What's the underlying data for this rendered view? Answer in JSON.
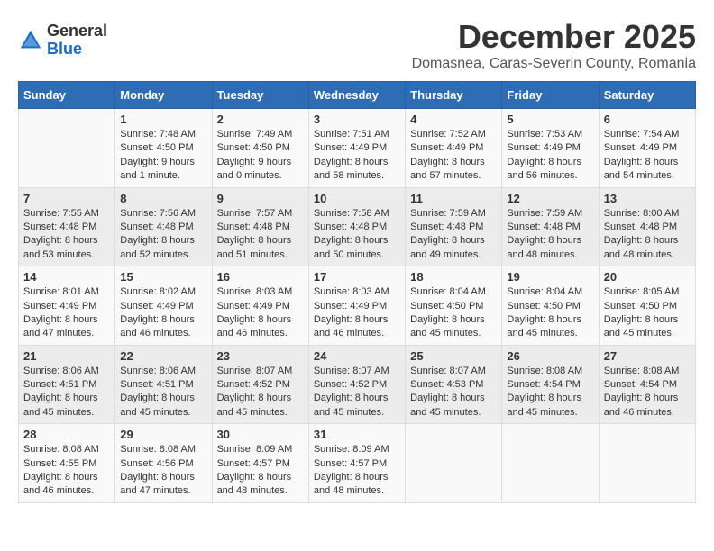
{
  "header": {
    "logo_general": "General",
    "logo_blue": "Blue",
    "title": "December 2025",
    "subtitle": "Domasnea, Caras-Severin County, Romania"
  },
  "weekdays": [
    "Sunday",
    "Monday",
    "Tuesday",
    "Wednesday",
    "Thursday",
    "Friday",
    "Saturday"
  ],
  "weeks": [
    [
      {
        "day": "",
        "sunrise": "",
        "sunset": "",
        "daylight": ""
      },
      {
        "day": "1",
        "sunrise": "Sunrise: 7:48 AM",
        "sunset": "Sunset: 4:50 PM",
        "daylight": "Daylight: 9 hours and 1 minute."
      },
      {
        "day": "2",
        "sunrise": "Sunrise: 7:49 AM",
        "sunset": "Sunset: 4:50 PM",
        "daylight": "Daylight: 9 hours and 0 minutes."
      },
      {
        "day": "3",
        "sunrise": "Sunrise: 7:51 AM",
        "sunset": "Sunset: 4:49 PM",
        "daylight": "Daylight: 8 hours and 58 minutes."
      },
      {
        "day": "4",
        "sunrise": "Sunrise: 7:52 AM",
        "sunset": "Sunset: 4:49 PM",
        "daylight": "Daylight: 8 hours and 57 minutes."
      },
      {
        "day": "5",
        "sunrise": "Sunrise: 7:53 AM",
        "sunset": "Sunset: 4:49 PM",
        "daylight": "Daylight: 8 hours and 56 minutes."
      },
      {
        "day": "6",
        "sunrise": "Sunrise: 7:54 AM",
        "sunset": "Sunset: 4:49 PM",
        "daylight": "Daylight: 8 hours and 54 minutes."
      }
    ],
    [
      {
        "day": "7",
        "sunrise": "Sunrise: 7:55 AM",
        "sunset": "Sunset: 4:48 PM",
        "daylight": "Daylight: 8 hours and 53 minutes."
      },
      {
        "day": "8",
        "sunrise": "Sunrise: 7:56 AM",
        "sunset": "Sunset: 4:48 PM",
        "daylight": "Daylight: 8 hours and 52 minutes."
      },
      {
        "day": "9",
        "sunrise": "Sunrise: 7:57 AM",
        "sunset": "Sunset: 4:48 PM",
        "daylight": "Daylight: 8 hours and 51 minutes."
      },
      {
        "day": "10",
        "sunrise": "Sunrise: 7:58 AM",
        "sunset": "Sunset: 4:48 PM",
        "daylight": "Daylight: 8 hours and 50 minutes."
      },
      {
        "day": "11",
        "sunrise": "Sunrise: 7:59 AM",
        "sunset": "Sunset: 4:48 PM",
        "daylight": "Daylight: 8 hours and 49 minutes."
      },
      {
        "day": "12",
        "sunrise": "Sunrise: 7:59 AM",
        "sunset": "Sunset: 4:48 PM",
        "daylight": "Daylight: 8 hours and 48 minutes."
      },
      {
        "day": "13",
        "sunrise": "Sunrise: 8:00 AM",
        "sunset": "Sunset: 4:48 PM",
        "daylight": "Daylight: 8 hours and 48 minutes."
      }
    ],
    [
      {
        "day": "14",
        "sunrise": "Sunrise: 8:01 AM",
        "sunset": "Sunset: 4:49 PM",
        "daylight": "Daylight: 8 hours and 47 minutes."
      },
      {
        "day": "15",
        "sunrise": "Sunrise: 8:02 AM",
        "sunset": "Sunset: 4:49 PM",
        "daylight": "Daylight: 8 hours and 46 minutes."
      },
      {
        "day": "16",
        "sunrise": "Sunrise: 8:03 AM",
        "sunset": "Sunset: 4:49 PM",
        "daylight": "Daylight: 8 hours and 46 minutes."
      },
      {
        "day": "17",
        "sunrise": "Sunrise: 8:03 AM",
        "sunset": "Sunset: 4:49 PM",
        "daylight": "Daylight: 8 hours and 46 minutes."
      },
      {
        "day": "18",
        "sunrise": "Sunrise: 8:04 AM",
        "sunset": "Sunset: 4:50 PM",
        "daylight": "Daylight: 8 hours and 45 minutes."
      },
      {
        "day": "19",
        "sunrise": "Sunrise: 8:04 AM",
        "sunset": "Sunset: 4:50 PM",
        "daylight": "Daylight: 8 hours and 45 minutes."
      },
      {
        "day": "20",
        "sunrise": "Sunrise: 8:05 AM",
        "sunset": "Sunset: 4:50 PM",
        "daylight": "Daylight: 8 hours and 45 minutes."
      }
    ],
    [
      {
        "day": "21",
        "sunrise": "Sunrise: 8:06 AM",
        "sunset": "Sunset: 4:51 PM",
        "daylight": "Daylight: 8 hours and 45 minutes."
      },
      {
        "day": "22",
        "sunrise": "Sunrise: 8:06 AM",
        "sunset": "Sunset: 4:51 PM",
        "daylight": "Daylight: 8 hours and 45 minutes."
      },
      {
        "day": "23",
        "sunrise": "Sunrise: 8:07 AM",
        "sunset": "Sunset: 4:52 PM",
        "daylight": "Daylight: 8 hours and 45 minutes."
      },
      {
        "day": "24",
        "sunrise": "Sunrise: 8:07 AM",
        "sunset": "Sunset: 4:52 PM",
        "daylight": "Daylight: 8 hours and 45 minutes."
      },
      {
        "day": "25",
        "sunrise": "Sunrise: 8:07 AM",
        "sunset": "Sunset: 4:53 PM",
        "daylight": "Daylight: 8 hours and 45 minutes."
      },
      {
        "day": "26",
        "sunrise": "Sunrise: 8:08 AM",
        "sunset": "Sunset: 4:54 PM",
        "daylight": "Daylight: 8 hours and 45 minutes."
      },
      {
        "day": "27",
        "sunrise": "Sunrise: 8:08 AM",
        "sunset": "Sunset: 4:54 PM",
        "daylight": "Daylight: 8 hours and 46 minutes."
      }
    ],
    [
      {
        "day": "28",
        "sunrise": "Sunrise: 8:08 AM",
        "sunset": "Sunset: 4:55 PM",
        "daylight": "Daylight: 8 hours and 46 minutes."
      },
      {
        "day": "29",
        "sunrise": "Sunrise: 8:08 AM",
        "sunset": "Sunset: 4:56 PM",
        "daylight": "Daylight: 8 hours and 47 minutes."
      },
      {
        "day": "30",
        "sunrise": "Sunrise: 8:09 AM",
        "sunset": "Sunset: 4:57 PM",
        "daylight": "Daylight: 8 hours and 48 minutes."
      },
      {
        "day": "31",
        "sunrise": "Sunrise: 8:09 AM",
        "sunset": "Sunset: 4:57 PM",
        "daylight": "Daylight: 8 hours and 48 minutes."
      },
      {
        "day": "",
        "sunrise": "",
        "sunset": "",
        "daylight": ""
      },
      {
        "day": "",
        "sunrise": "",
        "sunset": "",
        "daylight": ""
      },
      {
        "day": "",
        "sunrise": "",
        "sunset": "",
        "daylight": ""
      }
    ]
  ]
}
